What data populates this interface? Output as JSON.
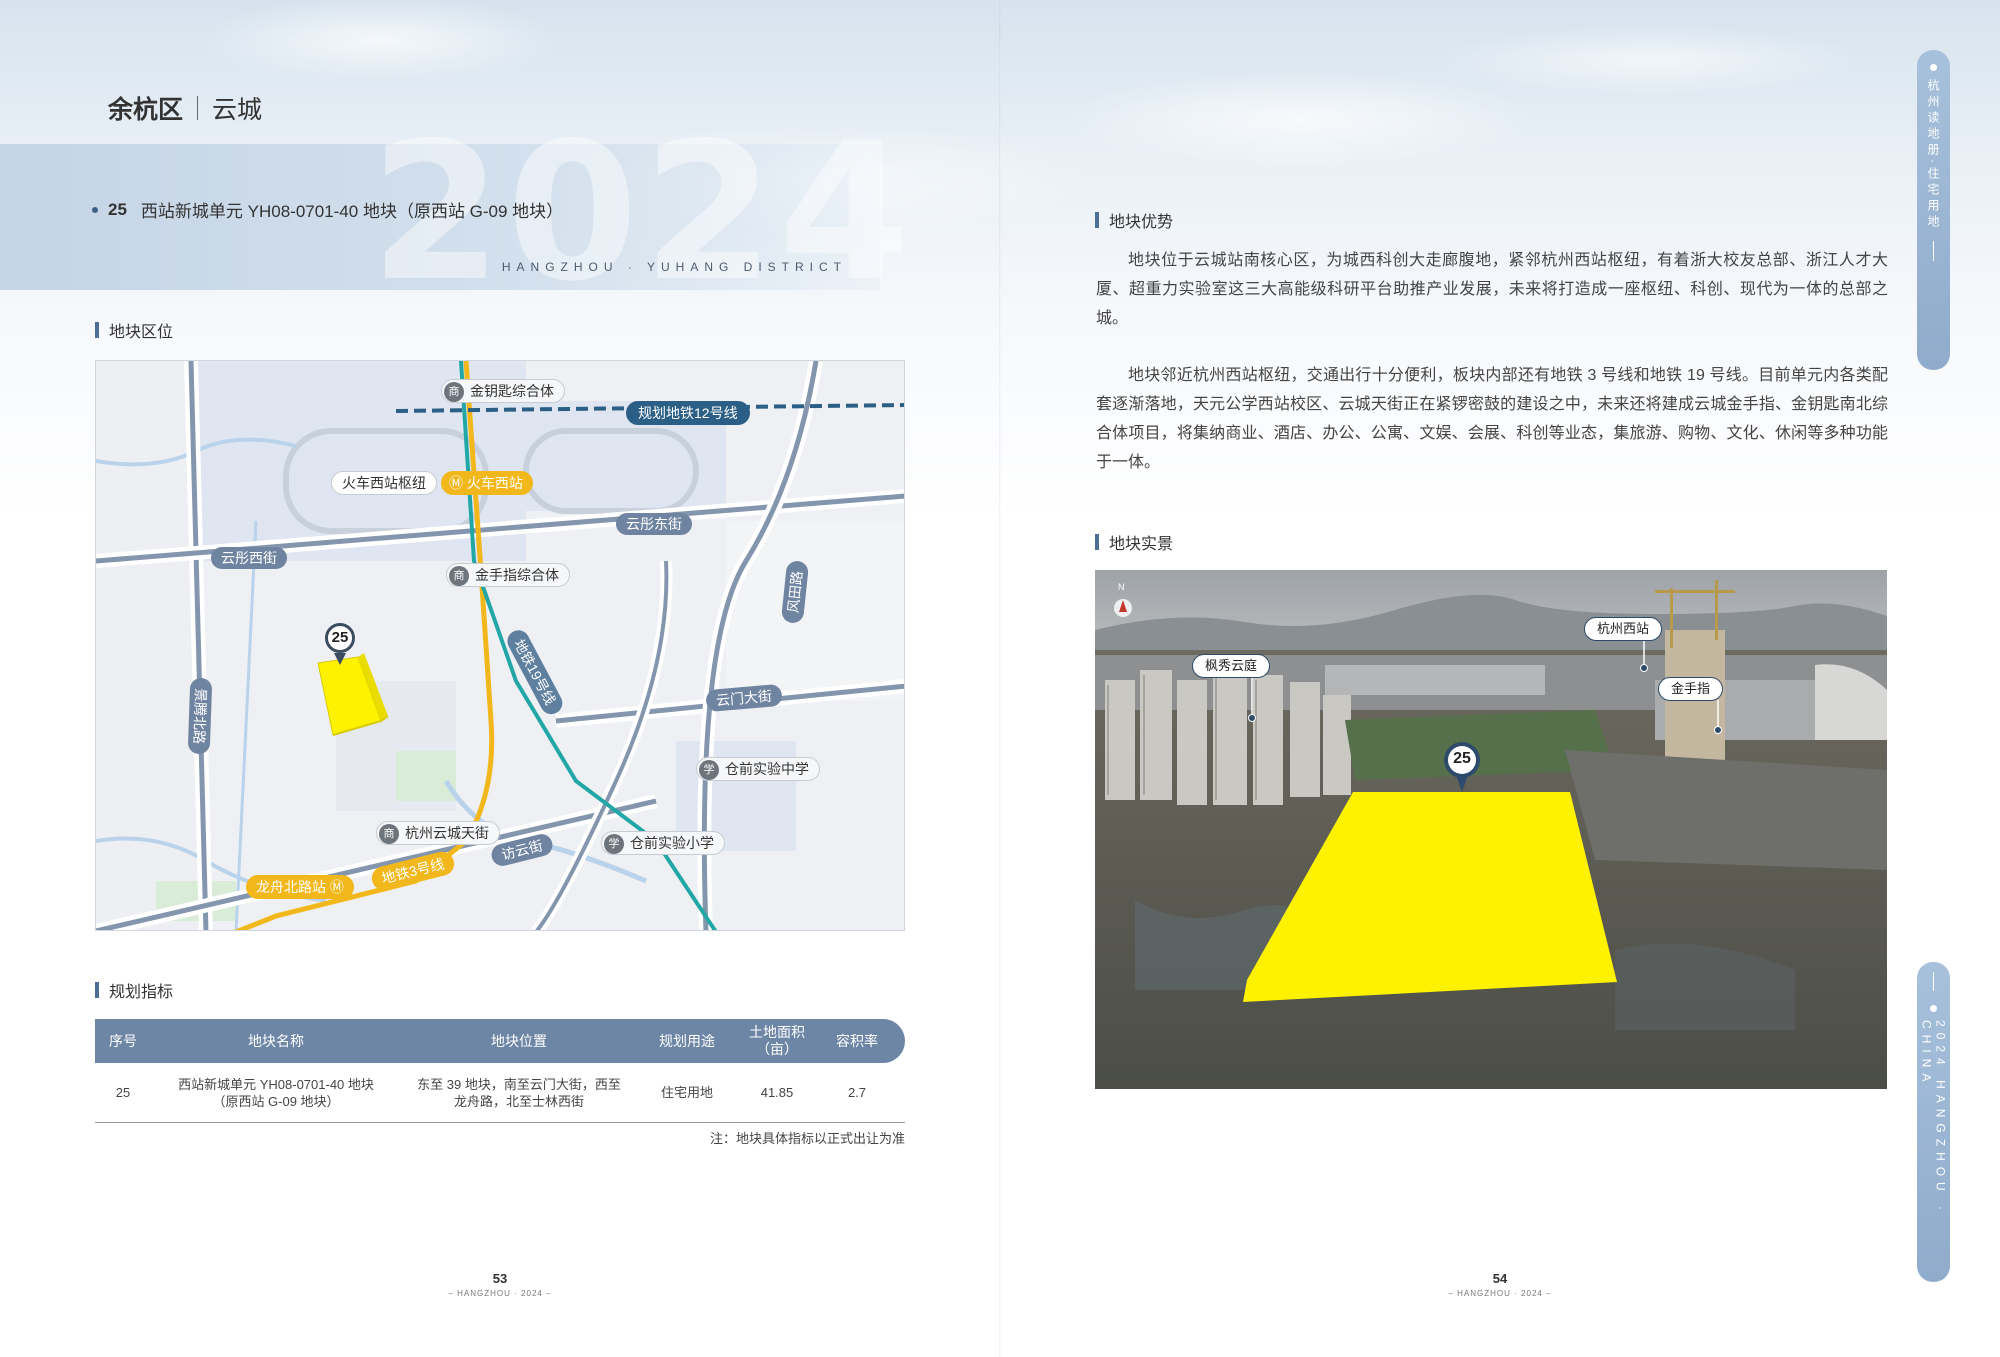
{
  "left_page": {
    "district_title": {
      "bold": "余杭区",
      "sub": "云城"
    },
    "banner_year": "2024",
    "banner_district": "HANGZHOU · YUHANG DISTRICT",
    "plot": {
      "number": "25",
      "title": "西站新城单元 YH08-0701-40 地块（原西站 G-09 地块）"
    },
    "location_heading": "地块区位",
    "map": {
      "labels": {
        "jinyaoshi": "金钥匙综合体",
        "metro12": "规划地铁12号线",
        "hub": "火车西站枢纽",
        "station_west": "火车西站",
        "yuntong_e": "云彤东街",
        "yuntong_w": "云彤西街",
        "jinshouzhi": "金手指综合体",
        "fengtan": "风田路",
        "line19": "地铁19号线",
        "yunmen": "云门大街",
        "jingteng": "景腾北路",
        "cangqian_mid": "仓前实验中学",
        "yuncheng_tianjie": "杭州云城天街",
        "fangyun": "访云街",
        "cangqian_pri": "仓前实验小学",
        "longzhou": "龙舟北路站",
        "line3": "地铁3号线"
      },
      "marker": "25"
    },
    "indicators_heading": "规划指标",
    "table": {
      "headers": [
        "序号",
        "地块名称",
        "地块位置",
        "规划用途",
        "土地面积\n（亩）",
        "容积率"
      ],
      "row": {
        "no": "25",
        "name_1": "西站新城单元 YH08-0701-40 地块",
        "name_2": "（原西站 G-09 地块）",
        "loc_1": "东至 39 地块，南至云门大街，西至",
        "loc_2": "龙舟路，北至士林西街",
        "use": "住宅用地",
        "area": "41.85",
        "far": "2.7"
      }
    },
    "note": "注：地块具体指标以正式出让为准",
    "page_no": "53",
    "page_sub": "– HANGZHOU · 2024 –"
  },
  "right_page": {
    "advantage_heading": "地块优势",
    "para1": "地块位于云城站南核心区，为城西科创大走廊腹地，紧邻杭州西站枢纽，有着浙大校友总部、浙江人才大厦、超重力实验室这三大高能级科研平台助推产业发展，未来将打造成一座枢纽、科创、现代为一体的总部之城。",
    "para2": "地块邻近杭州西站枢纽，交通出行十分便利，板块内部还有地铁 3 号线和地铁 19 号线。目前单元内各类配套逐渐落地，天元公学西站校区、云城天街正在紧锣密鼓的建设之中，未来还将建成云城金手指、金钥匙南北综合体项目，将集纳商业、酒店、办公、公寓、文娱、会展、科创等业态，集旅游、购物、文化、休闲等多种功能于一体。",
    "photo_heading": "地块实景",
    "photo": {
      "north": "N",
      "callout_fengxiu": "枫秀云庭",
      "callout_west_station": "杭州西站",
      "callout_jinshouzhi": "金手指",
      "marker": "25"
    },
    "page_no": "54",
    "page_sub": "– HANGZHOU · 2024 –",
    "side_tab_top": "杭州读地册·住宅用地",
    "side_tab_bottom": "2024 HANGZHOU · CHINA"
  },
  "colors": {
    "accent": "#4d6f96",
    "table_header": "#6e86a6",
    "plot_fill": "#fff200",
    "metro_blue": "#2b5f86",
    "station_yellow": "#f2b81b"
  }
}
